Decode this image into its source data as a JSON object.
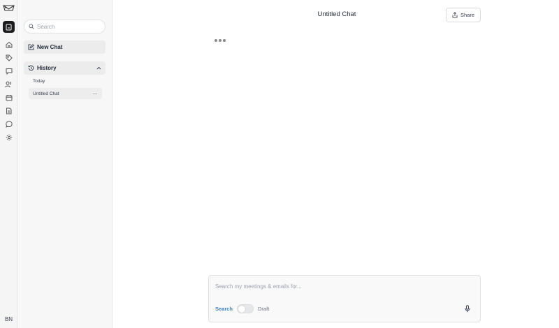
{
  "rail": {
    "icons": [
      "logo-icon",
      "chat-app-icon",
      "home-icon",
      "tag-icon",
      "messages-icon",
      "contacts-icon",
      "calendar-icon",
      "document-icon",
      "chat-bubble-icon",
      "settings-icon"
    ],
    "avatar_initials": "BN"
  },
  "sidebar": {
    "search_placeholder": "Search",
    "new_chat_label": "New Chat",
    "history_label": "History",
    "history_group": "Today",
    "history_items": [
      {
        "label": "Untitled Chat",
        "more": "···"
      }
    ]
  },
  "main": {
    "title": "Untitled Chat",
    "share_label": "Share",
    "composer": {
      "placeholder": "Search my meetings & emails for...",
      "mode_search": "Search",
      "mode_draft": "Draft",
      "draft_enabled": false
    }
  },
  "colors": {
    "accent": "#3b82c4",
    "active_rail": "#1c1c1e",
    "sidebar_bg": "#f7f7f7"
  }
}
